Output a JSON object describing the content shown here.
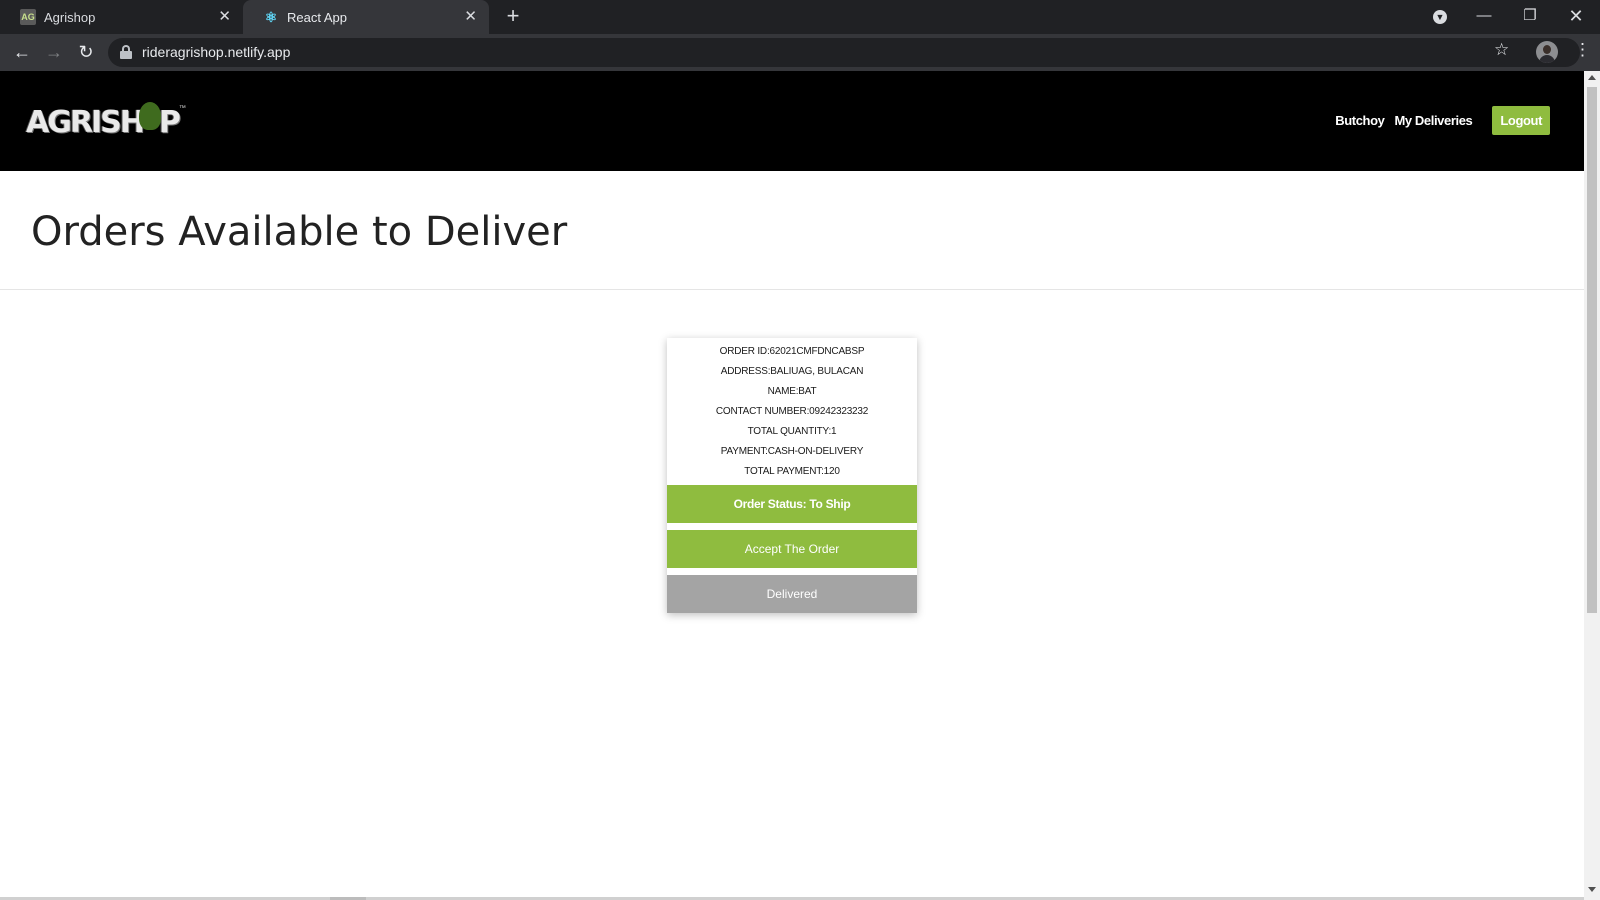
{
  "browser": {
    "tabs": [
      {
        "title": "Agrishop",
        "active": false,
        "favicon": "agrishop-favicon"
      },
      {
        "title": "React App",
        "active": true,
        "favicon": "react-favicon"
      }
    ],
    "url": "rideragrishop.netlify.app",
    "icons": {
      "back": "back-arrow-icon",
      "forward": "forward-arrow-icon",
      "reload": "reload-icon",
      "lock": "lock-icon",
      "bookmark": "star-icon",
      "profile": "profile-avatar",
      "menu": "kebab-menu-icon"
    }
  },
  "navbar": {
    "logo_text": "AGRISHOP",
    "user_name": "Butchoy",
    "my_deliveries_label": "My Deliveries",
    "logout_label": "Logout"
  },
  "page": {
    "title": "Orders Available to Deliver"
  },
  "order": {
    "order_id": "ORDER ID:62021CMFDNCABSP",
    "address": "ADDRESS:BALIUAG, BULACAN",
    "name": "NAME:BAT",
    "contact": "CONTACT NUMBER:09242323232",
    "total_quantity": "TOTAL QUANTITY:1",
    "payment": "PAYMENT:CASH-ON-DELIVERY",
    "total_payment": "TOTAL PAYMENT:120",
    "status_label": "Order Status: To Ship",
    "accept_label": "Accept The Order",
    "delivered_label": "Delivered"
  },
  "colors": {
    "accent_green": "#8fbc3f",
    "disabled_gray": "#a4a4a4",
    "navbar_bg": "#000000"
  }
}
